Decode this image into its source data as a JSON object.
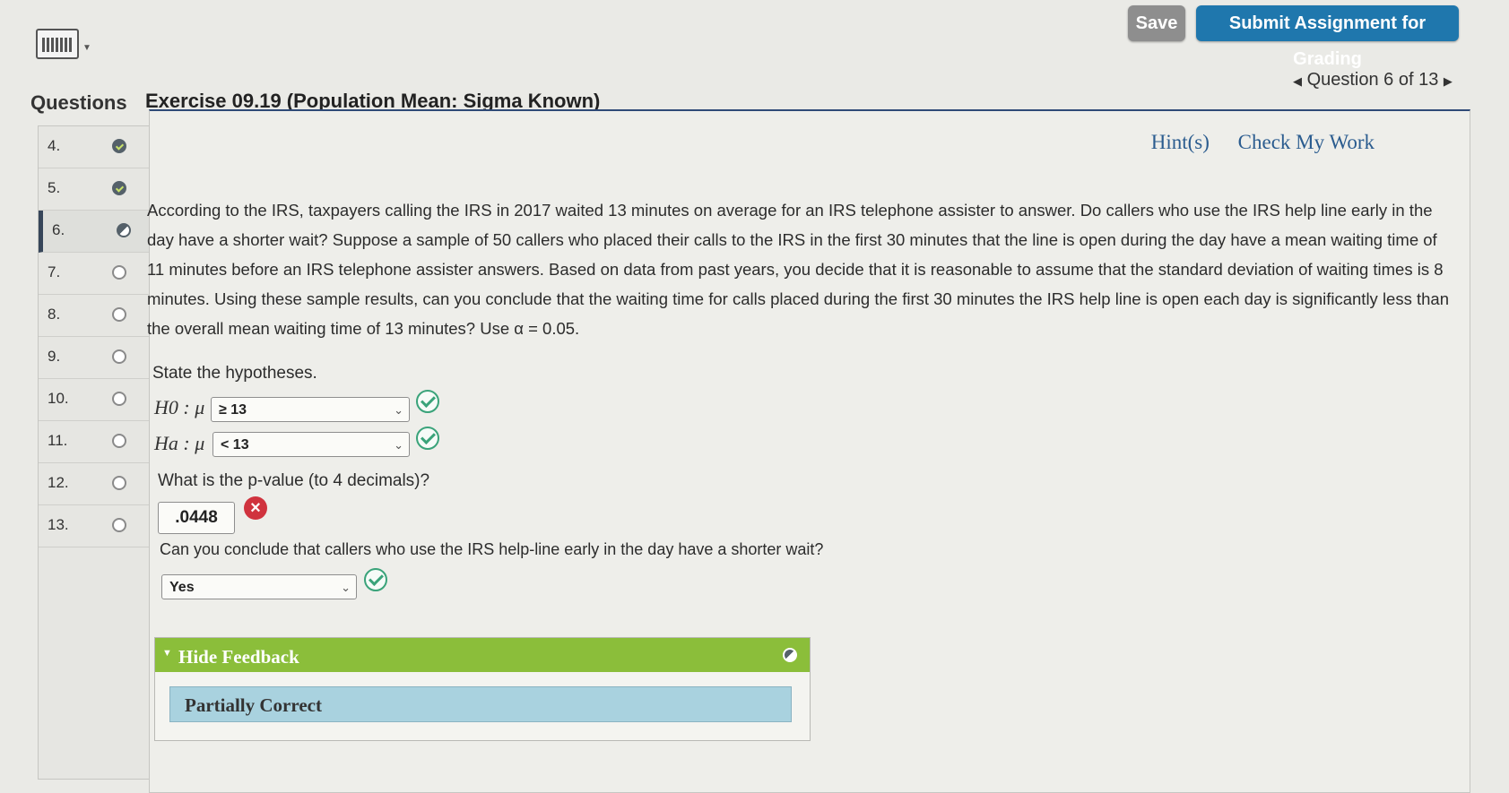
{
  "toolbar": {
    "save_label": "Save",
    "submit_label": "Submit Assignment for Grading",
    "question_counter": "Question 6 of 13",
    "prev_arrow": "◀",
    "next_arrow": "▶"
  },
  "sidebar": {
    "heading": "Questions",
    "items": [
      {
        "number": "4.",
        "status": "complete"
      },
      {
        "number": "5.",
        "status": "complete"
      },
      {
        "number": "6.",
        "status": "partial",
        "active": true
      },
      {
        "number": "7.",
        "status": "empty"
      },
      {
        "number": "8.",
        "status": "empty"
      },
      {
        "number": "9.",
        "status": "empty"
      },
      {
        "number": "10.",
        "status": "empty"
      },
      {
        "number": "11.",
        "status": "empty"
      },
      {
        "number": "12.",
        "status": "empty"
      },
      {
        "number": "13.",
        "status": "empty"
      }
    ]
  },
  "exercise": {
    "title": "Exercise 09.19 (Population Mean: Sigma Known)",
    "hint_label": "Hint(s)",
    "check_label": "Check My Work",
    "problem_text": "According to the IRS, taxpayers calling the IRS in 2017 waited 13 minutes on average for an IRS telephone assister to answer. Do callers who use the IRS help line early in the day have a shorter wait? Suppose a sample of 50 callers who placed their calls to the IRS in the first 30 minutes that the line is open during the day have a mean waiting time of 11 minutes before an IRS telephone assister answers. Based on data from past years, you decide that it is reasonable to assume that the standard deviation of waiting times is 8 minutes. Using these sample results, can you conclude that the waiting time for calls placed during the first 30 minutes the IRS help line is open each day is significantly less than the overall mean waiting time of 13 minutes? Use α = 0.05.",
    "hypotheses_prompt": "State the hypotheses.",
    "h0_label": "H0 : μ",
    "h0_value": "≥ 13",
    "ha_label": "Ha : μ",
    "ha_value": "< 13",
    "pvalue_prompt": "What is the p-value (to 4 decimals)?",
    "pvalue_answer": ".0448",
    "conclusion_prompt": "Can you conclude that callers who use the IRS help-line early in the day have a shorter wait?",
    "conclusion_value": "Yes"
  },
  "feedback": {
    "header": "Hide Feedback",
    "result": "Partially Correct"
  },
  "colors": {
    "submit": "#1f77ad",
    "save": "#8e8e8e",
    "feedback_header": "#8bbe3a",
    "feedback_body": "#a9d2df",
    "correct": "#3aa37a",
    "incorrect": "#d0333e"
  }
}
